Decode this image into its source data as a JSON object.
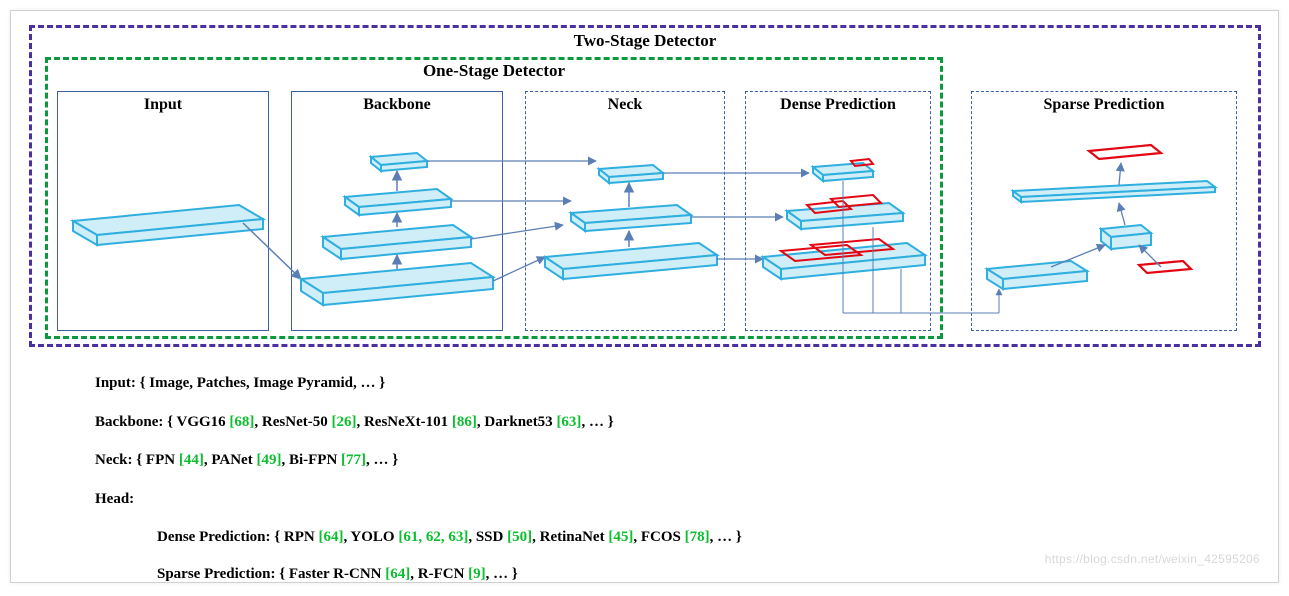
{
  "titles": {
    "two_stage": "Two-Stage Detector",
    "one_stage": "One-Stage Detector"
  },
  "boxes": {
    "input": "Input",
    "backbone": "Backbone",
    "neck": "Neck",
    "dense": "Dense Prediction",
    "sparse": "Sparse Prediction"
  },
  "desc": {
    "input_label": "Input: { ",
    "input_body": "Image, Patches, Image Pyramid, …",
    "close": " }",
    "backbone_label": "Backbone: { ",
    "bb_vgg": "VGG16 ",
    "bb_vgg_ref": "[68]",
    "bb_resnet": ", ResNet-50 ",
    "bb_resnet_ref": "[26]",
    "bb_resnext": ", ResNeXt-101 ",
    "bb_resnext_ref": "[86]",
    "bb_darknet": ", Darknet53 ",
    "bb_darknet_ref": "[63]",
    "bb_etc": ", …",
    "neck_label": "Neck: { ",
    "neck_fpn": "FPN ",
    "neck_fpn_ref": "[44]",
    "neck_panet": ", PANet ",
    "neck_panet_ref": "[49]",
    "neck_bifpn": ", Bi-FPN ",
    "neck_bifpn_ref": "[77]",
    "neck_etc": ", …",
    "head_label": "Head:",
    "dense_label": "Dense Prediction: { ",
    "d_rpn": "RPN ",
    "d_rpn_ref": "[64]",
    "d_yolo": ", YOLO ",
    "d_yolo_ref": "[61, 62, 63]",
    "d_ssd": ", SSD ",
    "d_ssd_ref": "[50]",
    "d_retina": ", RetinaNet ",
    "d_retina_ref": "[45]",
    "d_fcos": ", FCOS ",
    "d_fcos_ref": "[78]",
    "d_etc": ", …",
    "sparse_label": "Sparse Prediction: { ",
    "s_faster": "Faster R-CNN ",
    "s_faster_ref": "[64]",
    "s_rfcn": ",  R-FCN ",
    "s_rfcn_ref": "[9]",
    "s_etc": ", …"
  },
  "watermark": "https://blog.csdn.net/weixin_42595206",
  "colors": {
    "slab_fill": "#d0eef7",
    "slab_stroke": "#2faee0",
    "arrow": "#5b7fb5",
    "red": "#e30613"
  }
}
